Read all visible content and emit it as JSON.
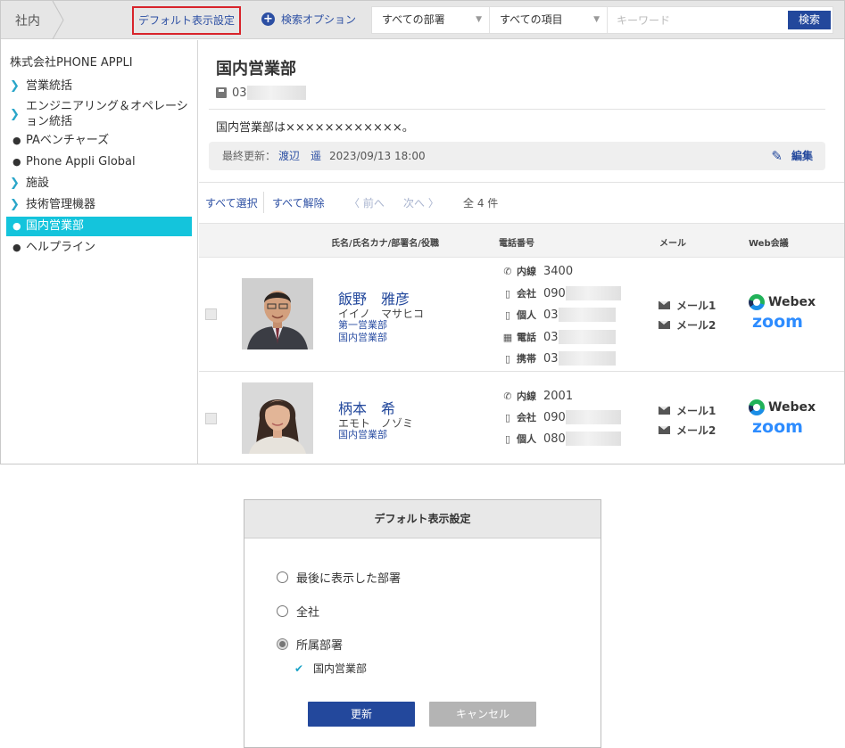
{
  "topbar": {
    "crumb": "社内",
    "default_setting": "デフォルト表示設定",
    "search_option": "検索オプション",
    "dept_select": "すべての部署",
    "item_select": "すべての項目",
    "keyword_placeholder": "キーワード",
    "search_button": "検索"
  },
  "sidebar": {
    "company": "株式会社PHONE APPLI",
    "items": [
      {
        "label": "営業統括",
        "type": "folder"
      },
      {
        "label": "エンジニアリング＆オペレーション統括",
        "type": "folder"
      },
      {
        "label": "PAベンチャーズ",
        "type": "leaf"
      },
      {
        "label": "Phone Appli Global",
        "type": "leaf"
      },
      {
        "label": "施設",
        "type": "folder"
      },
      {
        "label": "技術管理機器",
        "type": "folder"
      },
      {
        "label": "国内営業部",
        "type": "leaf",
        "active": true
      },
      {
        "label": "ヘルプライン",
        "type": "leaf"
      }
    ]
  },
  "dept": {
    "title": "国内営業部",
    "phone_prefix": "03",
    "description": "国内営業部は××××××××××××。",
    "updated_label": "最終更新：",
    "updated_by": "渡辺　遥",
    "updated_at": "2023/09/13 18:00",
    "edit_label": "編集"
  },
  "pager": {
    "select_all": "すべて選択",
    "deselect_all": "すべて解除",
    "prev": "前へ",
    "next": "次へ",
    "total": "全 4 件"
  },
  "table": {
    "col_name": "氏名/氏名カナ/部署名/役職",
    "col_phone": "電話番号",
    "col_mail": "メール",
    "col_web": "Web会議"
  },
  "people": [
    {
      "name": "飯野　雅彦",
      "kana": "イイノ　マサヒコ",
      "depts": [
        "第一営業部",
        "国内営業部"
      ],
      "phones": [
        {
          "label": "内線",
          "value": "3400"
        },
        {
          "label": "会社",
          "value": "090"
        },
        {
          "label": "個人",
          "value": "03"
        },
        {
          "label": "電話",
          "value": "03"
        },
        {
          "label": "携帯",
          "value": "03"
        }
      ],
      "mail1": "メール1",
      "mail2": "メール2",
      "webex": "Webex",
      "zoom": "zoom"
    },
    {
      "name": "柄本　希",
      "kana": "エモト　ノゾミ",
      "depts": [
        "国内営業部"
      ],
      "phones": [
        {
          "label": "内線",
          "value": "2001"
        },
        {
          "label": "会社",
          "value": "090"
        },
        {
          "label": "個人",
          "value": "080"
        }
      ],
      "mail1": "メール1",
      "mail2": "メール2",
      "webex": "Webex",
      "zoom": "zoom"
    }
  ],
  "dialog": {
    "title": "デフォルト表示設定",
    "options": [
      "最後に表示した部署",
      "全社",
      "所属部署"
    ],
    "selected_option": "所属部署",
    "sub_check": "国内営業部",
    "update_button": "更新",
    "cancel_button": "キャンセル"
  },
  "colors": {
    "accent": "#23489c",
    "active_nav": "#14c4dc",
    "highlight_border": "#d8242b",
    "zoom_blue": "#2d8cff"
  }
}
